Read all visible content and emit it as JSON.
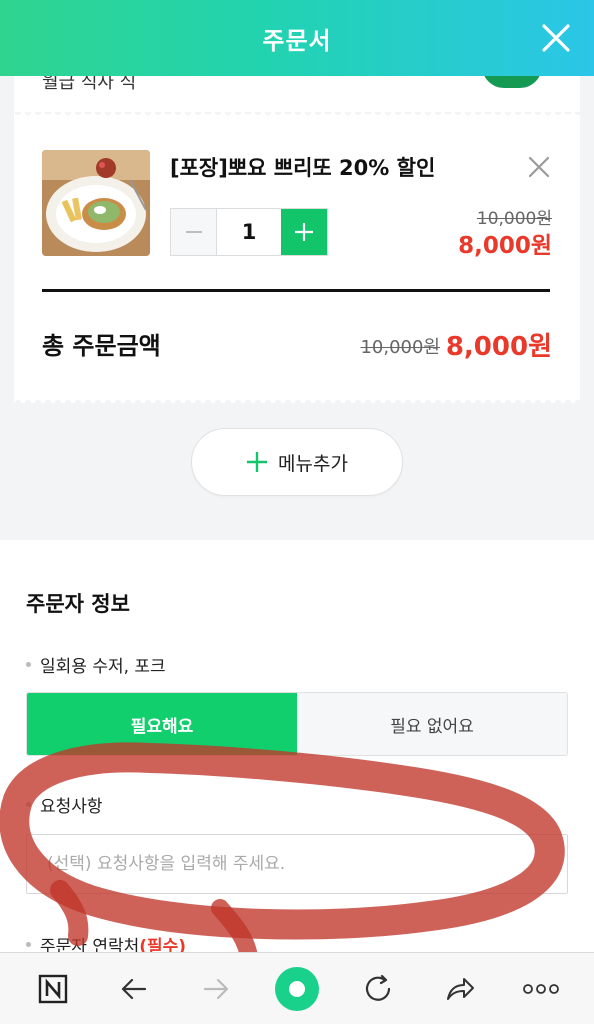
{
  "header": {
    "title": "주문서",
    "close_icon": "close-icon"
  },
  "peek": {
    "text": "월급 식사 식"
  },
  "order": {
    "item_name": "[포장]뽀요 쁘리또 20% 할인",
    "quantity": "1",
    "original_price": "10,000원",
    "sale_price": "8,000원",
    "total_label": "총 주문금액",
    "total_original": "10,000원",
    "total_sale": "8,000원"
  },
  "add_menu": {
    "label": "메뉴추가"
  },
  "orderer": {
    "title": "주문자 정보",
    "utensils_label": "일회용 수저, 포크",
    "need_option": "필요해요",
    "no_need_option": "필요 없어요",
    "request_label": "요청사항",
    "request_placeholder": "(선택) 요청사항을 입력해 주세요.",
    "contact_label": "주문자 연락처",
    "contact_required": "(필수)"
  },
  "colors": {
    "accent_green": "#12cf6d",
    "price_red": "#e8392b",
    "header_gradient_start": "#2fd48f",
    "header_gradient_end": "#2bc6e8"
  },
  "toolbar": {
    "icons": [
      "naver-n-icon",
      "back-arrow-icon",
      "forward-arrow-icon",
      "home-dot-icon",
      "refresh-icon",
      "share-icon",
      "more-icon"
    ]
  }
}
